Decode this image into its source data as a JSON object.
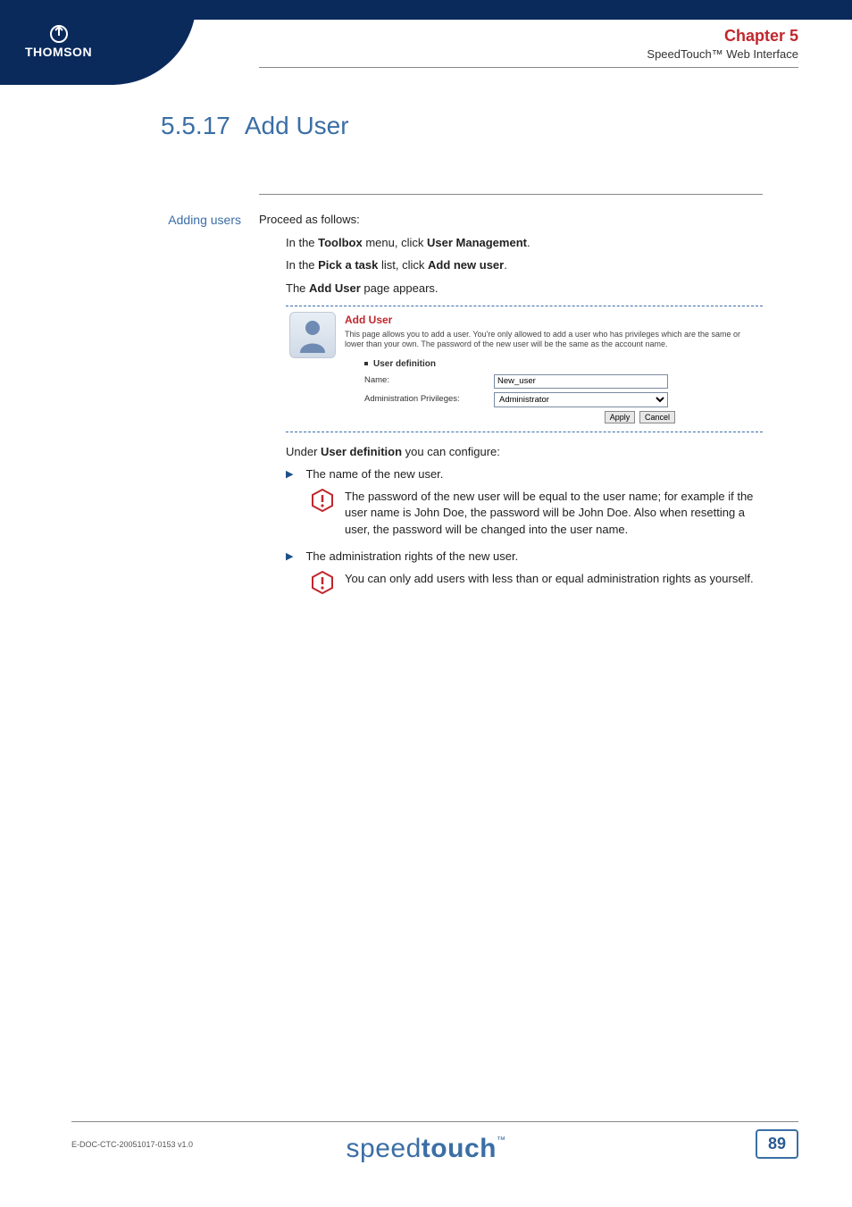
{
  "header": {
    "brand": "THOMSON",
    "chapter": "Chapter 5",
    "subtitle": "SpeedTouch™ Web Interface"
  },
  "section": {
    "number": "5.5.17",
    "title": "Add User"
  },
  "side_label": "Adding users",
  "body": {
    "intro": "Proceed as follows:",
    "step1_pre": "In the ",
    "step1_b1": "Toolbox",
    "step1_mid": " menu, click ",
    "step1_b2": "User Management",
    "step1_end": ".",
    "step2_pre": "In the ",
    "step2_b1": "Pick a task",
    "step2_mid": " list, click ",
    "step2_b2": "Add new user",
    "step2_end": ".",
    "step3_pre": "The ",
    "step3_b1": "Add User",
    "step3_end": " page appears.",
    "under_pre": "Under ",
    "under_b": "User definition",
    "under_end": " you can configure:",
    "li1": "The name of the new user.",
    "note1": "The password of the new user will be equal to the user name; for example if the user name is John Doe, the password will be John Doe. Also when resetting a user, the password will be changed into the user name.",
    "li2": "The administration rights of the new user.",
    "note2": "You can only add users with less than or equal administration rights as yourself."
  },
  "screenshot": {
    "title": "Add User",
    "desc": "This page allows you to add a user. You're only allowed to add a user who has privileges which are the same or lower than your own. The password of the new user will be the same as the account name.",
    "section_label": "User definition",
    "name_label": "Name:",
    "name_value": "New_user",
    "priv_label": "Administration Privileges:",
    "priv_value": "Administrator",
    "apply": "Apply",
    "cancel": "Cancel"
  },
  "footer": {
    "docref": "E-DOC-CTC-20051017-0153 v1.0",
    "brand_thin": "speed",
    "brand_bold": "touch",
    "tm": "™",
    "page": "89"
  }
}
